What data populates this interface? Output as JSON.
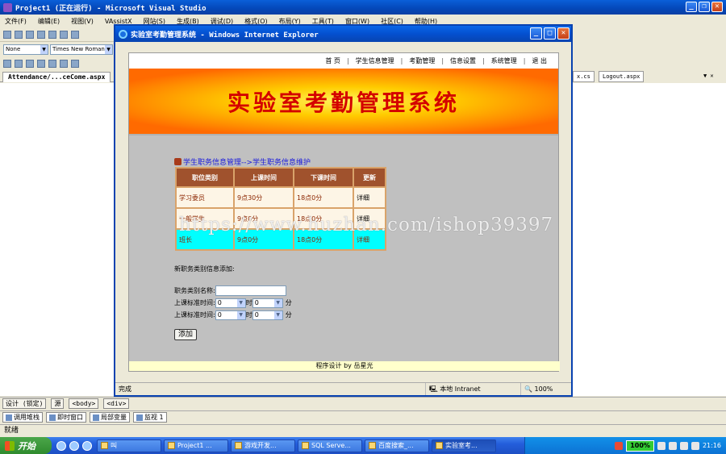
{
  "vs": {
    "title": "Project1 (正在运行) - Microsoft Visual Studio",
    "menu": [
      "文件(F)",
      "编辑(E)",
      "视图(V)",
      "VAssistX",
      "网站(S)",
      "生成(B)",
      "调试(D)",
      "格式(O)",
      "布局(Y)",
      "工具(T)",
      "窗口(W)",
      "社区(C)",
      "帮助(H)"
    ],
    "style_combo": "None",
    "font_combo": "Times New Roman",
    "editor_tab": "Attendance/...ceCome.aspx",
    "right_tab_1": "x.cs",
    "right_tab_2": "Logout.aspx",
    "design_btn": "设计 (锁定)",
    "split_label": "源",
    "tag_body": "<body>",
    "tag_div": "<div>",
    "debug_tabs": [
      "调用堆栈",
      "即时窗口",
      "局部变量",
      "监视 1"
    ],
    "status": "就绪"
  },
  "ie": {
    "title": "实验室考勤管理系统 - Windows Internet Explorer",
    "status_left": "完成",
    "zone": "本地 Intranet",
    "zoom": "100%"
  },
  "page": {
    "nav": [
      "首 页",
      "学生信息管理",
      "考勤管理",
      "信息设置",
      "系统管理",
      "退 出"
    ],
    "banner_title": "实验室考勤管理系统",
    "breadcrumb": "学生职务信息管理-->学生职务信息维护",
    "table": {
      "headers": [
        "职位类别",
        "上课时间",
        "下课时间",
        "更新"
      ],
      "rows": [
        [
          "学习委员",
          "9点30分",
          "18点0分",
          "详细"
        ],
        [
          "一般学生",
          "9点0分",
          "18点0分",
          "详细"
        ],
        [
          "班长",
          "9点0分",
          "18点0分",
          "详细"
        ]
      ]
    },
    "form": {
      "title": "新职务类别信息添加:",
      "name_label": "职务类别名称:",
      "start_label": "上课标准时间:",
      "end_label": "上课标准时间:",
      "hour_value": "0",
      "minute_value": "0",
      "hour_unit": "时",
      "minute_unit": "分",
      "add_button": "添加"
    },
    "footer": "程序设计 by 岳星光"
  },
  "taskbar": {
    "start": "开始",
    "tasks": [
      "叫",
      "Project1 ...",
      "游戏开发...",
      "SQL Serve...",
      "百度搜索_...",
      "实验室考..."
    ],
    "battery": "100%",
    "clock": "21:16"
  },
  "watermark": "https://www.huzhan.com/ishop39397"
}
